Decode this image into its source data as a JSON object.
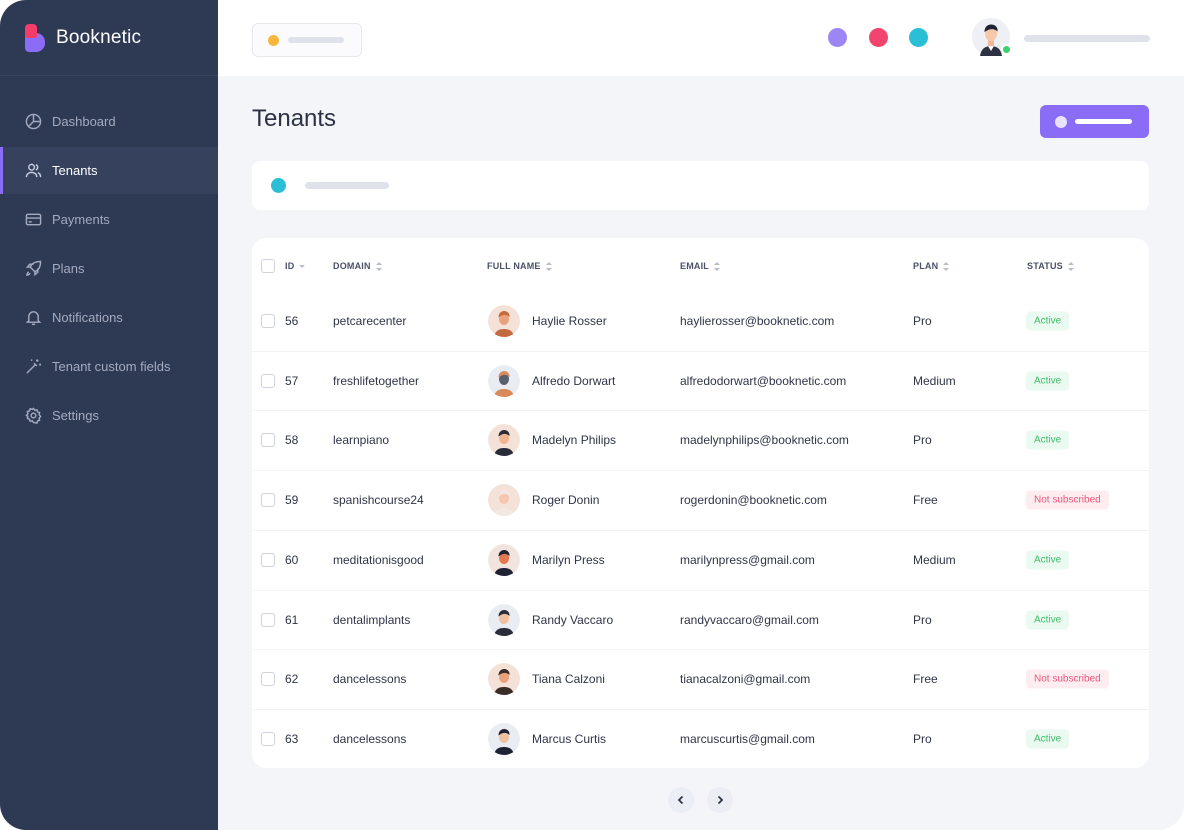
{
  "app": {
    "name": "Booknetic"
  },
  "sidebar": {
    "items": [
      {
        "label": "Dashboard",
        "icon": "dashboard-icon",
        "active": false
      },
      {
        "label": "Tenants",
        "icon": "users-icon",
        "active": true
      },
      {
        "label": "Payments",
        "icon": "credit-card-icon",
        "active": false
      },
      {
        "label": "Plans",
        "icon": "rocket-icon",
        "active": false
      },
      {
        "label": "Notifications",
        "icon": "bell-icon",
        "active": false
      },
      {
        "label": "Tenant custom fields",
        "icon": "magic-wand-icon",
        "active": false
      },
      {
        "label": "Settings",
        "icon": "gear-icon",
        "active": false
      }
    ]
  },
  "topbar": {
    "dots": [
      "#9b86f3",
      "#f2456e",
      "#2bbfd6"
    ]
  },
  "page": {
    "title": "Tenants"
  },
  "colors": {
    "accent": "#8b6cf6",
    "sidebar": "#2e3954",
    "active_badge": "#3fbf6a",
    "not_subscribed_badge": "#f0577a"
  },
  "table": {
    "headers": {
      "id": "ID",
      "domain": "DOMAIN",
      "full_name": "FULL NAME",
      "email": "EMAIL",
      "plan": "PLAN",
      "status": "STATUS"
    },
    "rows": [
      {
        "id": "56",
        "domain": "petcarecenter",
        "name": "Haylie Rosser",
        "email": "haylierosser@booknetic.com",
        "plan": "Pro",
        "status": "Active",
        "status_type": "active"
      },
      {
        "id": "57",
        "domain": "freshlifetogether",
        "name": "Alfredo Dorwart",
        "email": "alfredodorwart@booknetic.com",
        "plan": "Medium",
        "status": "Active",
        "status_type": "active"
      },
      {
        "id": "58",
        "domain": "learnpiano",
        "name": "Madelyn Philips",
        "email": "madelynphilips@booknetic.com",
        "plan": "Pro",
        "status": "Active",
        "status_type": "active"
      },
      {
        "id": "59",
        "domain": "spanishcourse24",
        "name": "Roger Donin",
        "email": "rogerdonin@booknetic.com",
        "plan": "Free",
        "status": "Not subscribed",
        "status_type": "not"
      },
      {
        "id": "60",
        "domain": "meditationisgood",
        "name": "Marilyn Press",
        "email": "marilynpress@gmail.com",
        "plan": "Medium",
        "status": "Active",
        "status_type": "active"
      },
      {
        "id": "61",
        "domain": "dentalimplants",
        "name": "Randy Vaccaro",
        "email": "randyvaccaro@gmail.com",
        "plan": "Pro",
        "status": "Active",
        "status_type": "active"
      },
      {
        "id": "62",
        "domain": "dancelessons",
        "name": "Tiana Calzoni",
        "email": "tianacalzoni@gmail.com",
        "plan": "Free",
        "status": "Not subscribed",
        "status_type": "not"
      },
      {
        "id": "63",
        "domain": "dancelessons",
        "name": "Marcus Curtis",
        "email": "marcuscurtis@gmail.com",
        "plan": "Pro",
        "status": "Active",
        "status_type": "active"
      }
    ]
  }
}
